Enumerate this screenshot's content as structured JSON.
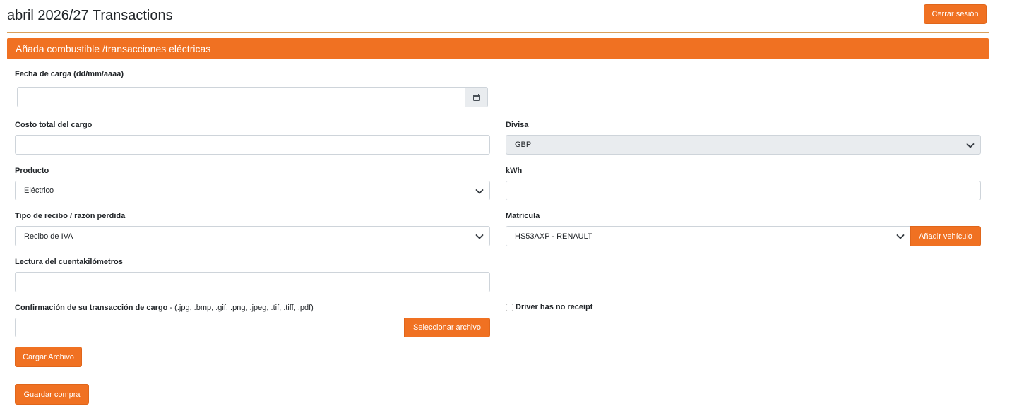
{
  "header": {
    "title": "abril 2026/27 Transactions",
    "logout_label": "Cerrar sesión"
  },
  "panel": {
    "heading": "Añada combustible /transacciones eléctricas"
  },
  "form": {
    "charge_date": {
      "label": "Fecha de carga (dd/mm/aaaa)",
      "value": "",
      "icon": "calendar-icon"
    },
    "total_cost": {
      "label": "Costo total del cargo",
      "value": ""
    },
    "currency": {
      "label": "Divisa",
      "selected": "GBP"
    },
    "product": {
      "label": "Producto",
      "selected": "Eléctrico"
    },
    "kwh": {
      "label": "kWh",
      "value": ""
    },
    "receipt_type": {
      "label": "Tipo de recibo / razón perdida",
      "selected": "Recibo de IVA"
    },
    "plate": {
      "label": "Matrícula",
      "selected": "HS53AXP - RENAULT",
      "add_vehicle_label": "Añadir vehículo"
    },
    "odometer": {
      "label": "Lectura del cuentakilómetros",
      "value": ""
    },
    "confirmation": {
      "label": "Confirmación de su transacción de cargo",
      "hint": " - (.jpg, .bmp, .gif, .png, .jpeg, .tif, .tiff, .pdf)",
      "value": "",
      "select_file_label": "Seleccionar archivo"
    },
    "no_receipt": {
      "label": "Driver has no receipt",
      "checked": false
    },
    "upload_label": "Cargar Archivo",
    "save_label": "Guardar compra"
  },
  "colors": {
    "accent": "#f07122",
    "rule": "#d9a05b",
    "disabled_bg": "#e9ecef"
  }
}
